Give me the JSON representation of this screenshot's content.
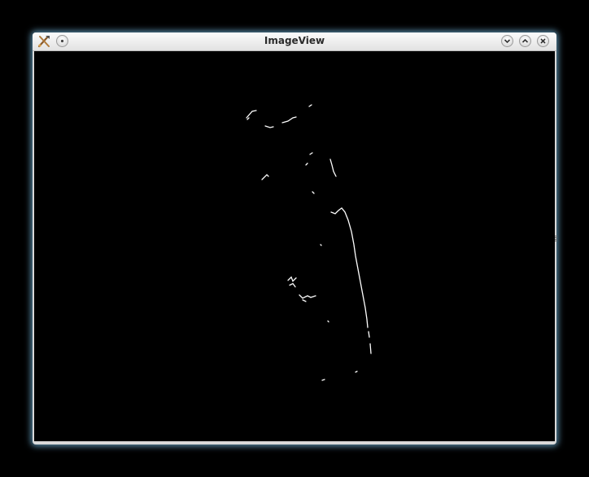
{
  "window": {
    "title": "ImageView"
  },
  "titlebar_buttons": {
    "menu": "window-menu",
    "minimize": "minimize",
    "maximize": "maximize",
    "close": "close"
  },
  "icons": {
    "app": "imageview-app-icon",
    "menu": "dot-icon",
    "minimize": "chevron-down-icon",
    "maximize": "chevron-up-icon",
    "close": "close-icon"
  },
  "image": {
    "background": "#000000",
    "edge_color": "#ffffff"
  },
  "colors": {
    "glow": "#78bee6",
    "titlebar": "#f0f0f0"
  }
}
